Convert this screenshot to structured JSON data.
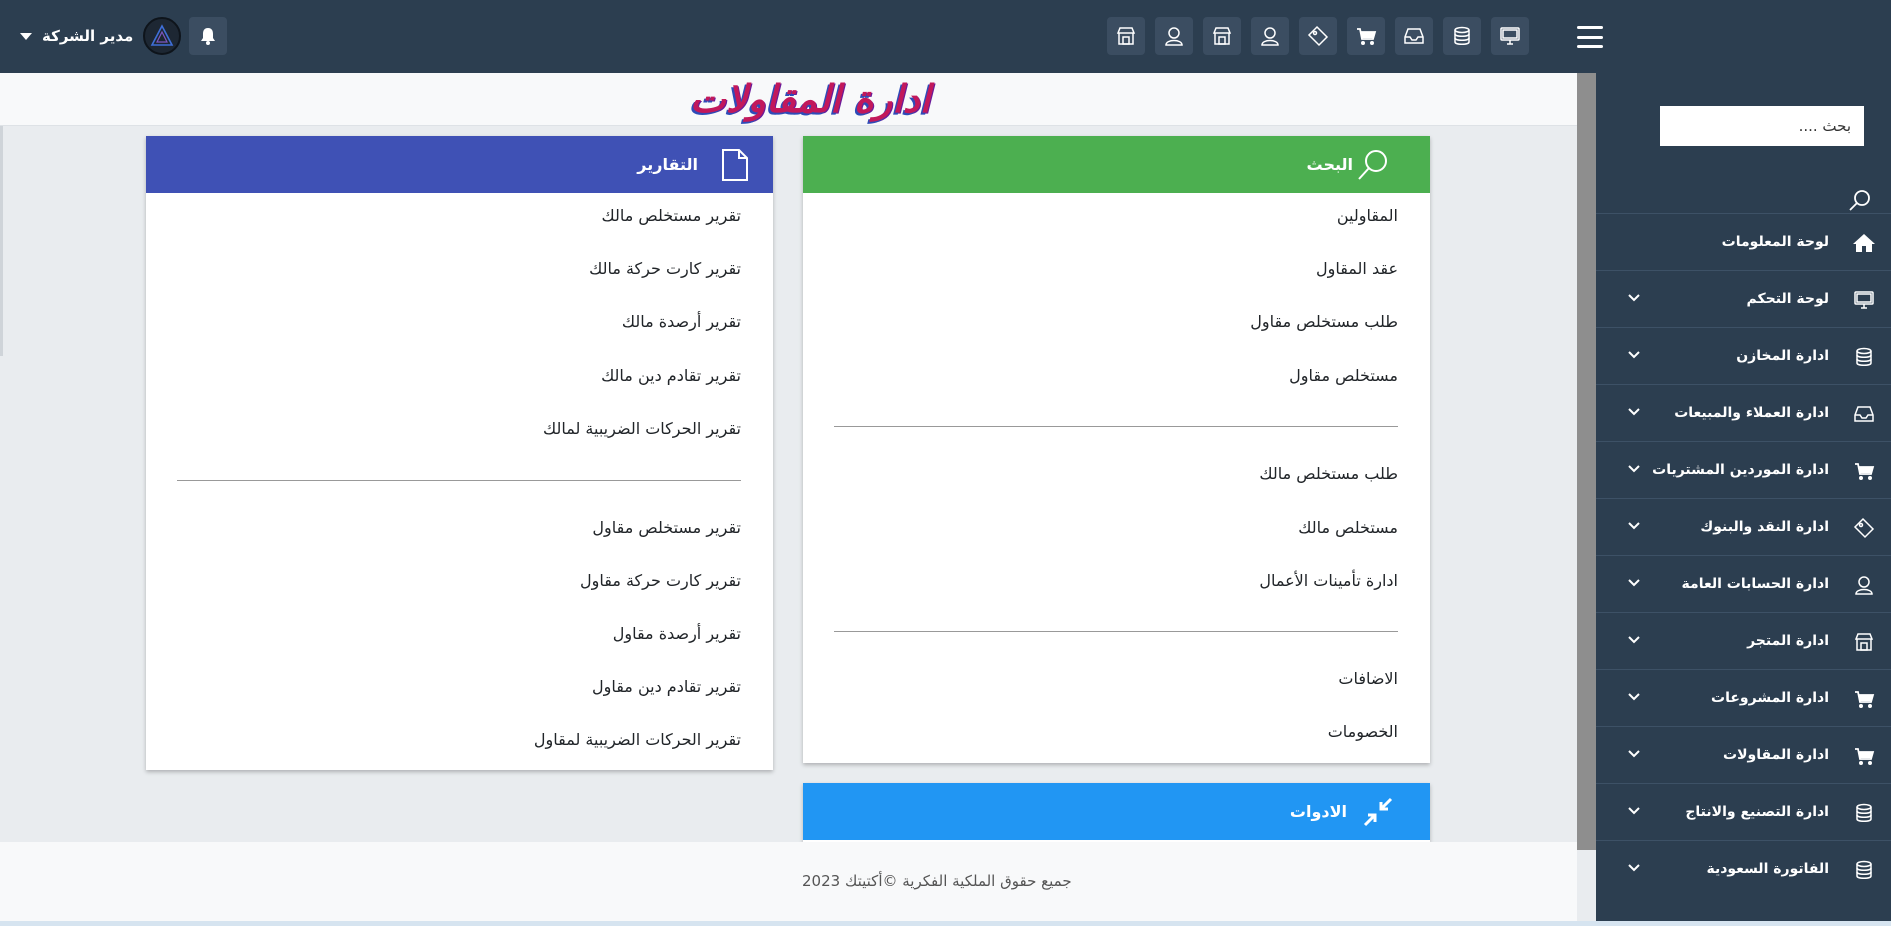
{
  "header": {
    "user_name": "مدير الشركة",
    "top_icons": [
      "store-icon",
      "user-icon",
      "store-icon",
      "user-icon",
      "ticket-icon",
      "cart-icon",
      "inbox-icon",
      "database-icon",
      "monitor-icon"
    ]
  },
  "sidebar": {
    "search_placeholder": "بحث ....",
    "items": [
      {
        "label": "لوحة المعلومات",
        "icon": "home-icon",
        "has_chevron": false
      },
      {
        "label": "لوحة التحكم",
        "icon": "monitor-icon",
        "has_chevron": true
      },
      {
        "label": "ادارة المخازن",
        "icon": "database-icon",
        "has_chevron": true
      },
      {
        "label": "ادارة العملاء والمبيعات",
        "icon": "inbox-icon",
        "has_chevron": true
      },
      {
        "label": "ادارة الموردين المشتريات",
        "icon": "cart-icon",
        "has_chevron": true
      },
      {
        "label": "ادارة النقد والبنوك",
        "icon": "ticket-icon",
        "has_chevron": true
      },
      {
        "label": "ادارة الحسابات العامة",
        "icon": "user-icon",
        "has_chevron": true
      },
      {
        "label": "ادارة المتجر",
        "icon": "store-icon",
        "has_chevron": true
      },
      {
        "label": "ادارة المشروعات",
        "icon": "cart-icon",
        "has_chevron": true
      },
      {
        "label": "ادارة المقاولات",
        "icon": "cart-icon",
        "has_chevron": true
      },
      {
        "label": "ادارة التصنيع والانتاج",
        "icon": "database-icon",
        "has_chevron": true
      },
      {
        "label": "الفاتورة السعودية",
        "icon": "database-icon",
        "has_chevron": true
      }
    ]
  },
  "main": {
    "title": "ادارة المقاولات",
    "search_card": {
      "title": "البحث",
      "color": "#4caf50",
      "group1": [
        "المقاولين",
        "عقد المقاول",
        "طلب مستخلص مقاول",
        "مستخلص مقاول"
      ],
      "group2": [
        "طلب مستخلص مالك",
        "مستخلص مالك",
        "ادارة تأمينات الأعمال"
      ],
      "group3": [
        "الاضافات",
        "الخصومات"
      ]
    },
    "reports_card": {
      "title": "التقارير",
      "color": "#3f51b5",
      "group1": [
        "تقرير مستخلص مالك",
        "تقرير كارت حركة مالك",
        "تقرير أرصدة مالك",
        "تقرير تقادم دين مالك",
        "تقرير الحركات الضريبية لمالك"
      ],
      "group2": [
        "تقرير مستخلص مقاول",
        "تقرير كارت حركة مقاول",
        "تقرير أرصدة مقاول",
        "تقرير تقادم دين مقاول",
        "تقرير الحركات الضريبية لمقاول"
      ]
    },
    "tools_card": {
      "title": "الادوات",
      "color": "#2196f3"
    }
  },
  "footer": {
    "text": "جميع حقوق الملكية الفكرية ©أكتيتك 2023"
  }
}
